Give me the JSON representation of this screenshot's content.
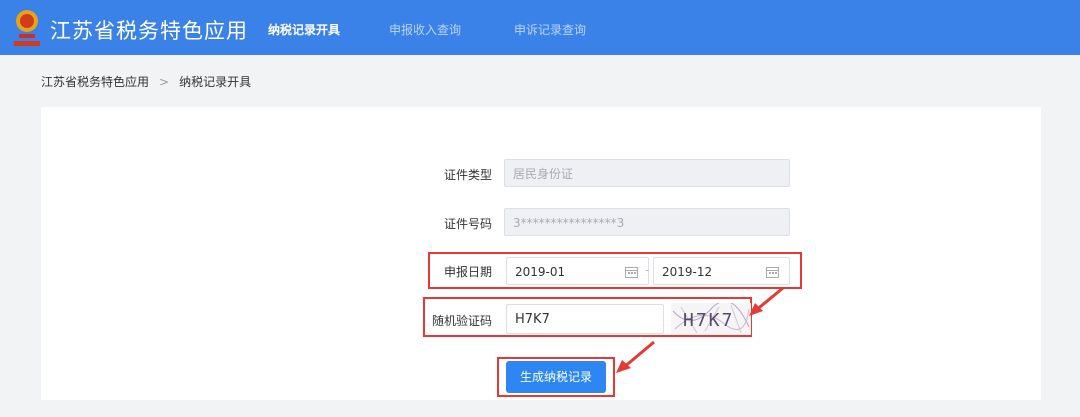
{
  "header": {
    "app_title": "江苏省税务特色应用",
    "nav": [
      "纳税记录开具",
      "申报收入查询",
      "申诉记录查询"
    ],
    "active_nav": 0
  },
  "breadcrumb": {
    "root": "江苏省税务特色应用",
    "separator": ">",
    "current": "纳税记录开具"
  },
  "form": {
    "id_type_label": "证件类型",
    "id_type_value": "居民身份证",
    "id_number_label": "证件号码",
    "id_number_value": "3****************3",
    "period_label": "申报日期",
    "period_start": "2019-01",
    "period_end": "2019-12",
    "captcha_label": "随机验证码",
    "captcha_input": "H7K7",
    "captcha_image_text": "H7K7",
    "submit_label": "生成纳税记录"
  },
  "colors": {
    "header": "#3b82e8",
    "button": "#2d86f1",
    "highlight": "#e53935"
  }
}
